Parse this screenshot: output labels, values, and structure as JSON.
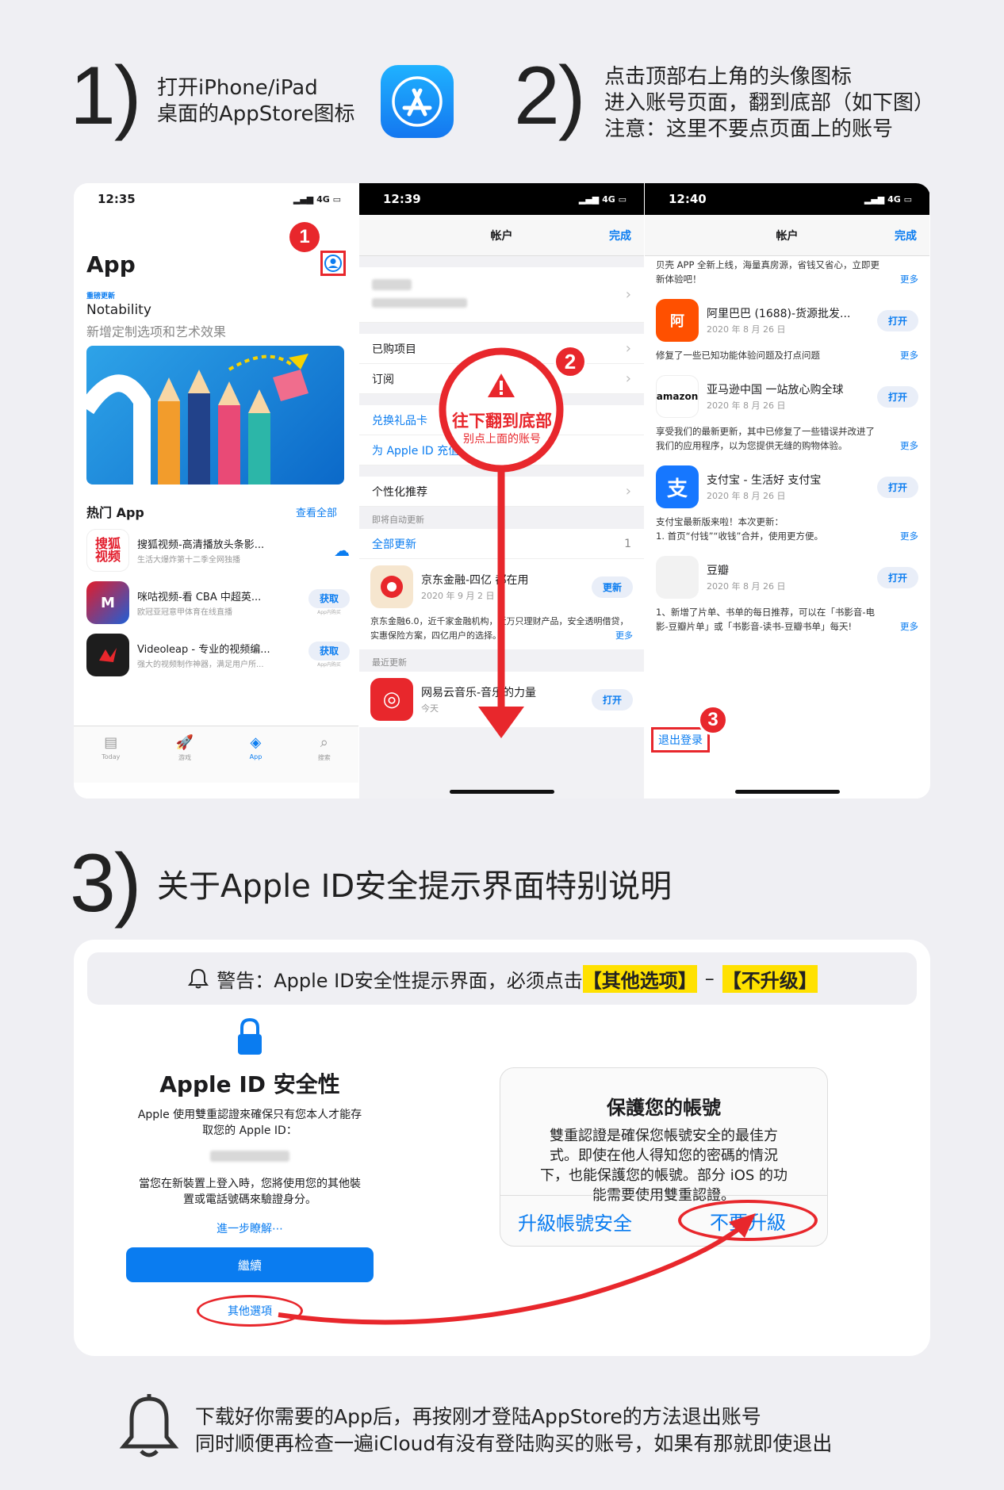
{
  "steps": {
    "s1_num": "1)",
    "s1_line1": "打开iPhone/iPad",
    "s1_line2": "桌面的AppStore图标",
    "s2_num": "2)",
    "s2_line1": "点击顶部右上角的头像图标",
    "s2_line2": "进入账号页面，翻到底部（如下图）",
    "s2_line3": "注意：这里不要点页面上的账号",
    "s3_num": "3)",
    "s3_title": "关于Apple ID安全提示界面特别说明"
  },
  "p1": {
    "time": "12:35",
    "signal": "4G",
    "title": "App",
    "badge_num": "1",
    "feature_tag": "重磅更新",
    "feature_title": "Notability",
    "feature_sub": "新增定制选项和艺术效果",
    "hot_title": "热门 App",
    "see_all": "查看全部",
    "apps": [
      {
        "name": "搜狐视频-高清播放头条影...",
        "desc": "生活大爆炸第十二季全网独播",
        "action": "",
        "icon_text": "搜狐\n视频"
      },
      {
        "name": "咪咕视频-看 CBA 中超英...",
        "desc": "欧冠亚冠意甲体育在线直播",
        "action": "获取",
        "sub": "App内购买",
        "icon_text": "M"
      },
      {
        "name": "Videoleap - 专业的视频编...",
        "desc": "强大的视频制作神器，满足用户所...",
        "action": "获取",
        "sub": "App内购买",
        "icon_text": ""
      }
    ],
    "tabs": [
      "Today",
      "游戏",
      "App",
      "搜索"
    ]
  },
  "p2": {
    "time": "12:39",
    "signal": "4G",
    "nav_title": "帐户",
    "done": "完成",
    "purchased": "已购项目",
    "subscriptions": "订阅",
    "redeem": "兑换礼品卡",
    "topup": "为 Apple ID 充值",
    "personalized": "个性化推荐",
    "auto_update_sect": "即将自动更新",
    "update_all": "全部更新",
    "count": "1",
    "jd_name": "京东金融-四亿 都在用",
    "jd_date": "2020 年 9 月 2 日",
    "jd_btn": "更新",
    "jd_note": "京东金融6.0，近千家金融机构，近万只理财产品，安全透明借贷，实惠保险方案，四亿用户的选择。",
    "more": "更多",
    "recent_sect": "最近更新",
    "ne_name": "网易云音乐-音乐的力量",
    "ne_date": "今天",
    "ne_btn": "打开",
    "overlay_line1": "往下翻到底部",
    "overlay_line2": "别点上面的账号",
    "badge_num": "2"
  },
  "p3": {
    "time": "12:40",
    "signal": "4G",
    "nav_title": "帐户",
    "done": "完成",
    "top_note_1": "贝壳 APP 全新上线，海量真房源，省钱又省心，立即更",
    "top_note_2": "新体验吧！",
    "more": "更多",
    "apps": [
      {
        "name": "阿里巴巴 (1688)-货源批发...",
        "date": "2020 年 8 月 26 日",
        "btn": "打开",
        "note1": "修复了一些已知功能体验问题及打点问题",
        "note2": ""
      },
      {
        "name": "亚马逊中国 一站放心购全球",
        "date": "2020 年 8 月 26 日",
        "btn": "打开",
        "note1": "享受我们的最新更新，其中已修复了一些错误并改进了",
        "note2": "我们的应用程序，以为您提供无缝的购物体验。"
      },
      {
        "name": "支付宝 - 生活好 支付宝",
        "date": "2020 年 8 月 26 日",
        "btn": "打开",
        "note1": "支付宝最新版来啦！本次更新：",
        "note2": "1. 首页“付钱”“收钱”合并，使用更方便。"
      },
      {
        "name": "豆瓣",
        "date": "2020 年 8 月 26 日",
        "btn": "打开",
        "note1": "1、新增了片单、书单的每日推荐，可以在「书影音-电",
        "note2": "影-豆瓣片单」或「书影音-读书-豆瓣书单」每天!"
      }
    ],
    "logout": "退出登录",
    "badge_num": "3"
  },
  "warning": {
    "prefix": "警告：Apple ID安全性提示界面，必须点击",
    "opt1": "【其他选项】",
    "dash": "–",
    "opt2": "【不升级】"
  },
  "dialog_left": {
    "title": "Apple ID 安全性",
    "body1": "Apple 使用雙重認證來確保只有您本人才能存",
    "body2": "取您的 Apple ID：",
    "body3": "當您在新裝置上登入時，您將使用您的其他裝",
    "body4": "置或電話號碼來驗證身分。",
    "learn_more": "進一步瞭解⋯",
    "continue": "繼續",
    "other": "其他選項"
  },
  "dialog_right": {
    "title": "保護您的帳號",
    "l1": "雙重認證是確保您帳號安全的最佳方",
    "l2": "式。即使在他人得知您的密碼的情況",
    "l3": "下，也能保護您的帳號。部分 iOS 的功",
    "l4": "能需要使用雙重認證。",
    "upgrade": "升級帳號安全",
    "no_upgrade": "不要升級"
  },
  "footer": {
    "line1": "下载好你需要的App后，再按刚才登陆AppStore的方法退出账号",
    "line2": "同时顺便再检查一遍iCloud有没有登陆购买的账号，如果有那就即使退出"
  },
  "colors": {
    "accent": "#0a7cf0",
    "red": "#e8272c",
    "highlight": "#ffe100"
  }
}
